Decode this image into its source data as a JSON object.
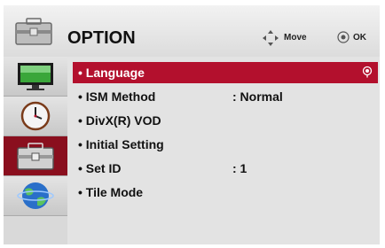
{
  "header": {
    "title": "OPTION",
    "icon": "option-toolbox-icon",
    "hints": [
      {
        "icon": "move-arrows-icon",
        "label": "Move"
      },
      {
        "icon": "ok-button-icon",
        "label": "OK"
      }
    ]
  },
  "sidebar": {
    "items": [
      {
        "icon": "picture-monitor-icon",
        "active": false
      },
      {
        "icon": "time-clock-icon",
        "active": false
      },
      {
        "icon": "option-toolbox-icon",
        "active": true
      },
      {
        "icon": "network-globe-icon",
        "active": false
      }
    ]
  },
  "menu": {
    "rows": [
      {
        "label": "• Language",
        "value": "",
        "selected": true
      },
      {
        "label": "• ISM Method",
        "value": ": Normal",
        "selected": false
      },
      {
        "label": "• DivX(R) VOD",
        "value": "",
        "selected": false
      },
      {
        "label": "• Initial Setting",
        "value": "",
        "selected": false
      },
      {
        "label": "• Set ID",
        "value": ": 1",
        "selected": false
      },
      {
        "label": "• Tile Mode",
        "value": "",
        "selected": false
      }
    ]
  },
  "colors": {
    "selected_row": "#b3102d",
    "active_tab": "#8a0f1e",
    "panel": "#e3e3e3"
  }
}
